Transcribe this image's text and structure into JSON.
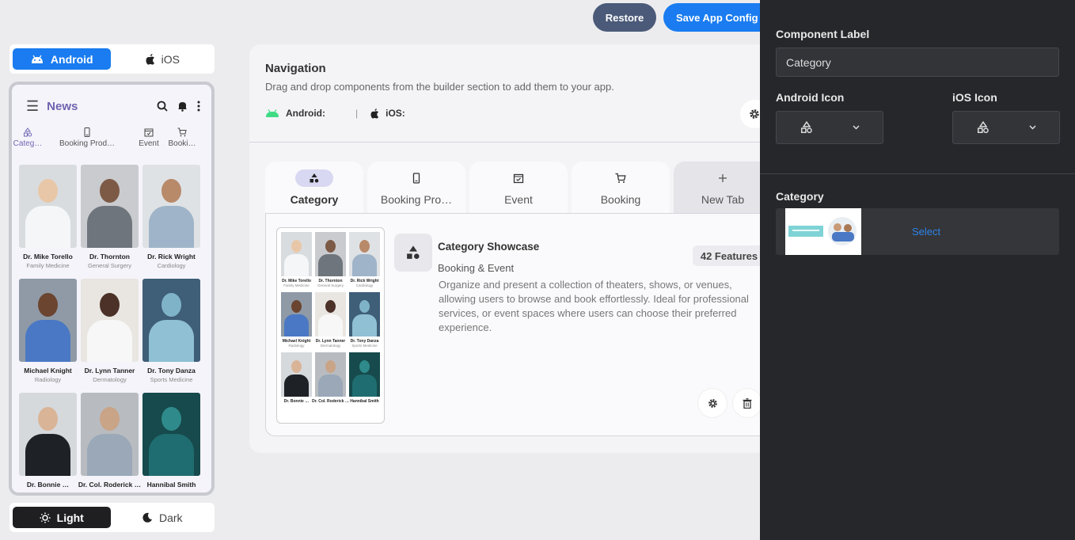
{
  "toolbar": {
    "restore_label": "Restore",
    "save_label": "Save App Config"
  },
  "platform_toggle": {
    "android": "Android",
    "ios": "iOS",
    "selected": "Android"
  },
  "theme_toggle": {
    "light": "Light",
    "dark": "Dark",
    "selected": "Light"
  },
  "phone": {
    "title": "News",
    "tabs": [
      "Categ…",
      "Booking Prod…",
      "Event",
      "Booki…"
    ],
    "cards": [
      {
        "name": "Dr. Mike Torello",
        "specialty": "Family Medicine"
      },
      {
        "name": "Dr. Thornton",
        "specialty": "General Surgery"
      },
      {
        "name": "Dr. Rick Wright",
        "specialty": "Cardiology"
      },
      {
        "name": "Michael Knight",
        "specialty": "Radiology"
      },
      {
        "name": "Dr. Lynn Tanner",
        "specialty": "Dermatology"
      },
      {
        "name": "Dr. Tony Danza",
        "specialty": "Sports Medicine"
      },
      {
        "name": "Dr. Bonnie …",
        "specialty": ""
      },
      {
        "name": "Dr. Col. Roderick …",
        "specialty": ""
      },
      {
        "name": "Hannibal Smith",
        "specialty": ""
      }
    ]
  },
  "navigation": {
    "title": "Navigation",
    "description": "Drag and drop components from the builder section to add them to your app.",
    "android_label": "Android:",
    "ios_label": "iOS:",
    "separator": "|",
    "tabs": [
      {
        "label": "Category",
        "icon": "category-icon"
      },
      {
        "label": "Booking Pro…",
        "icon": "phone-icon"
      },
      {
        "label": "Event",
        "icon": "calendar-icon"
      },
      {
        "label": "Booking",
        "icon": "cart-icon"
      },
      {
        "label": "New Tab",
        "icon": "plus-icon"
      }
    ]
  },
  "component": {
    "title": "Category Showcase",
    "subtitle": "Booking & Event",
    "features": "42 Features",
    "description": "Organize and present a collection of theaters, shows, or venues, allowing users to browse and book effortlessly. Ideal for professional services, or event spaces where users can choose their preferred experience."
  },
  "sidebar": {
    "component_label_title": "Component Label",
    "component_label_value": "Category",
    "android_icon_title": "Android Icon",
    "ios_icon_title": "iOS Icon",
    "category_title": "Category",
    "select_label": "Select"
  },
  "colors": {
    "accent": "#1a7cf0",
    "restore": "#4b5a78",
    "side_bg": "#26272b",
    "tab_active_pill": "#d8d8f2"
  }
}
